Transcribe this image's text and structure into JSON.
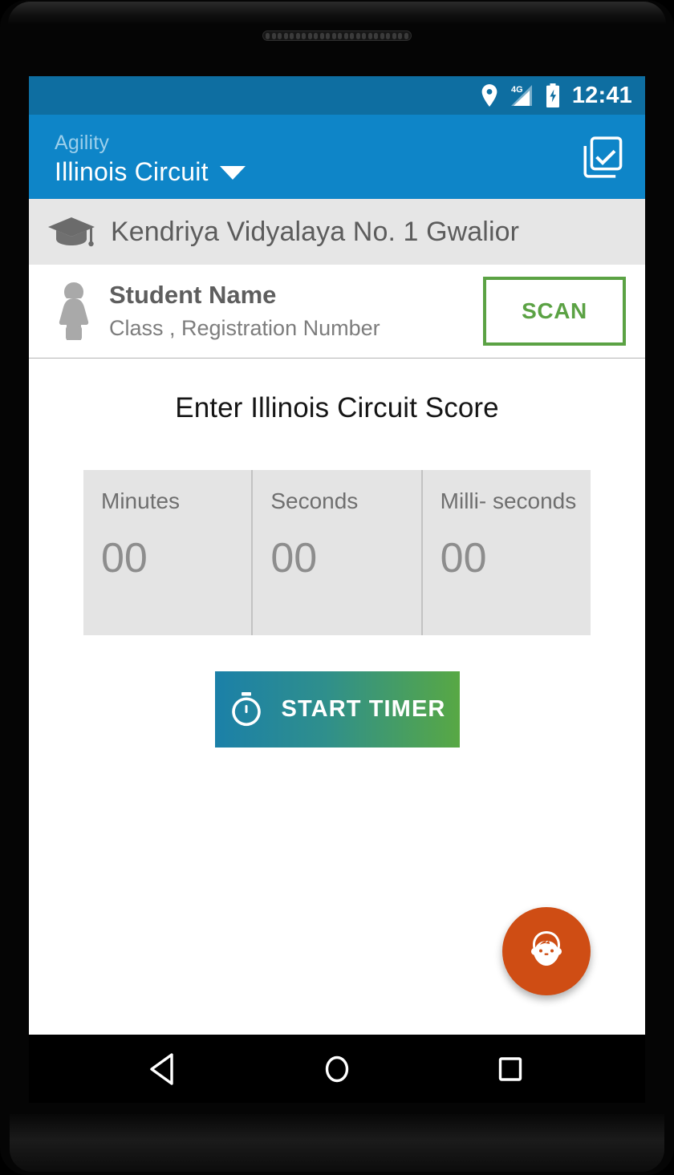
{
  "status_bar": {
    "time": "12:41",
    "network_label": "4G",
    "icons": [
      "location-pin-icon",
      "signal-4g-icon",
      "battery-charging-icon"
    ]
  },
  "app_bar": {
    "subtitle": "Agility",
    "title": "Illinois Circuit",
    "dropdown_icon": "chevron-down-icon",
    "action_icon": "library-add-check-icon"
  },
  "school": {
    "icon": "graduation-cap-icon",
    "name": "Kendriya Vidyalaya No. 1 Gwalior"
  },
  "student": {
    "icon": "student-girl-icon",
    "name": "Student Name",
    "meta": "Class , Registration Number",
    "scan_label": "SCAN"
  },
  "main": {
    "heading": "Enter Illinois Circuit Score",
    "time_fields": [
      {
        "label": "Minutes",
        "value": "00"
      },
      {
        "label": "Seconds",
        "value": "00"
      },
      {
        "label": "Milli- seconds",
        "value": "00"
      }
    ],
    "start_timer_label": "START TIMER",
    "start_timer_icon": "stopwatch-icon",
    "fab_icon": "child-face-icon"
  },
  "nav_bar": {
    "back_label": "back-icon",
    "home_label": "home-icon",
    "recents_label": "recents-icon"
  },
  "colors": {
    "status_bar": "#0e6ea1",
    "app_bar": "#0e85c8",
    "scan_green": "#5ba244",
    "fab_orange": "#cf4d14",
    "timer_gradient_start": "#1b80a8",
    "timer_gradient_end": "#58a844"
  }
}
